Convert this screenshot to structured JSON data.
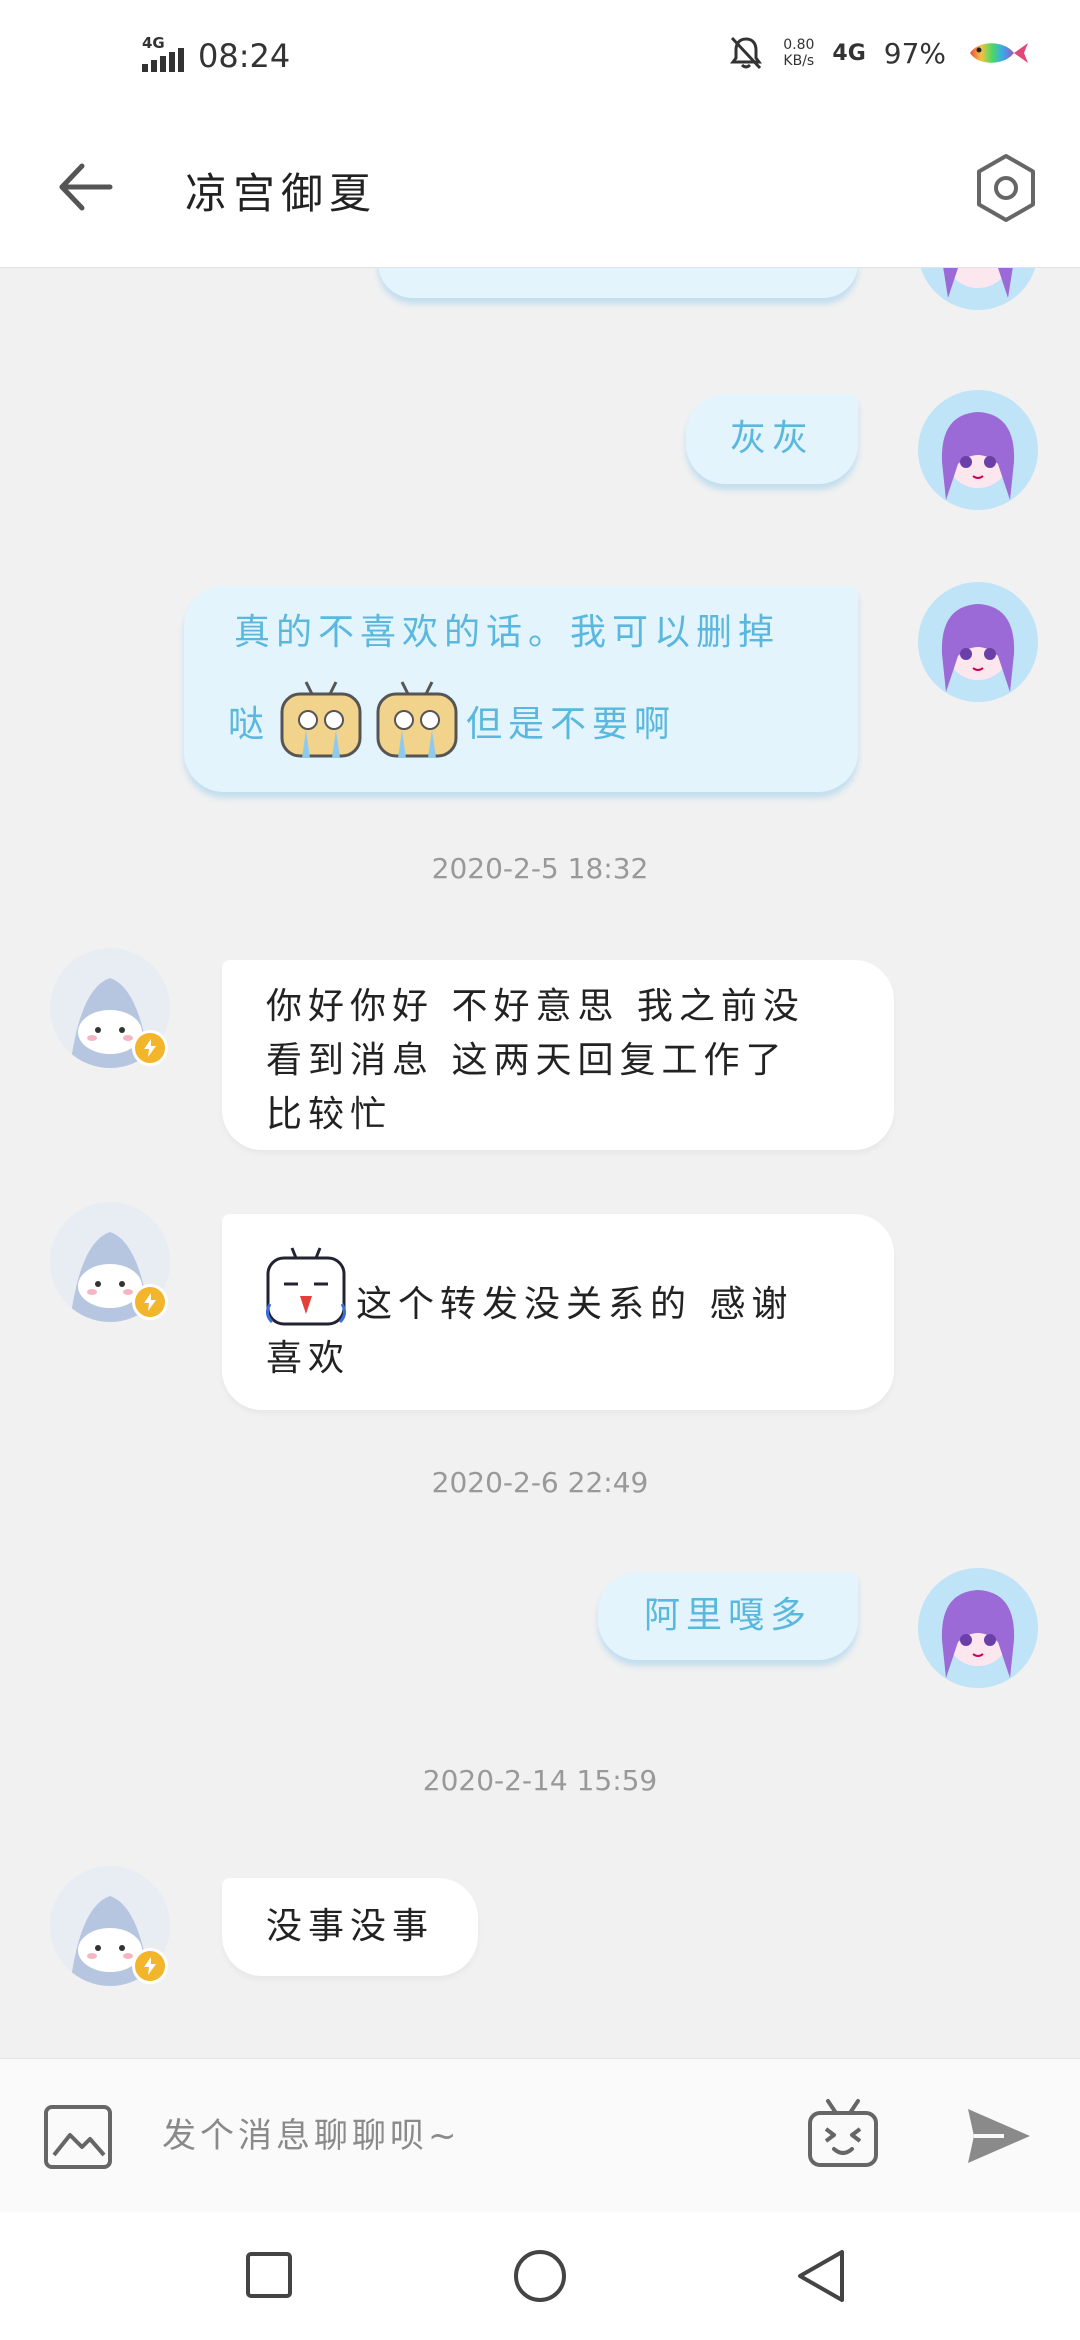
{
  "status_bar": {
    "network_tag": "4G",
    "time": "08:24",
    "speed_value": "0.80",
    "speed_unit": "KB/s",
    "network": "4G",
    "battery": "97%"
  },
  "header": {
    "title": "凉宫御夏",
    "back_icon": "arrow-left-icon",
    "settings_icon": "hexagon-settings-icon"
  },
  "messages": {
    "me_1": "灰灰",
    "me_2_line1": "真的不喜欢的话。我可以删掉",
    "me_2_pre": "哒",
    "me_2_post": "但是不要啊",
    "time_1": "2020-2-5 18:32",
    "them_1_line1": "你好你好 不好意思 我之前没",
    "them_1_line2": "看到消息 这两天回复工作了",
    "them_1_line3": "比较忙",
    "them_2_line1": "这个转发没关系的 感谢",
    "them_2_line2": "喜欢",
    "time_2": "2020-2-6 22:49",
    "me_3": "阿里嘎多",
    "time_3": "2020-2-14 15:59",
    "them_3": "没事没事"
  },
  "input_bar": {
    "placeholder": "发个消息聊聊呗~",
    "image_icon": "image-icon",
    "emoji_icon": "bilibili-tv-emoji-icon",
    "send_icon": "send-icon"
  },
  "nav_bar": {
    "recent_icon": "square-icon",
    "home_icon": "circle-icon",
    "back_icon": "triangle-back-icon"
  },
  "colors": {
    "my_bubble": "#e3f4fd",
    "my_text": "#5ab8de",
    "their_bubble": "#ffffff",
    "badge": "#f3b52a",
    "background": "#f1f1f1"
  }
}
